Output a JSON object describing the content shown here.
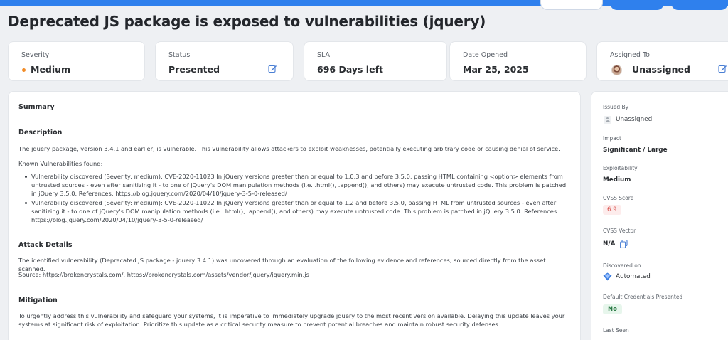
{
  "page": {
    "title": "Deprecated JS package is exposed to vulnerabilities (jquery)"
  },
  "cards": {
    "severity": {
      "label": "Severity",
      "value": "Medium",
      "dot_color": "#f28c28"
    },
    "status": {
      "label": "Status",
      "value": "Presented",
      "icon": "edit-icon"
    },
    "sla": {
      "label": "SLA",
      "value": "696 Days left"
    },
    "date_opened": {
      "label": "Date Opened",
      "value": "Mar 25, 2025"
    },
    "assigned_to": {
      "label": "Assigned To",
      "value": "Unassigned",
      "icon": "edit-icon"
    }
  },
  "main": {
    "summary_heading": "Summary",
    "description": {
      "heading": "Description",
      "text": "The jquery package, version 3.4.1 and earlier, is vulnerable. This vulnerability allows attackers to exploit weaknesses, potentially executing arbitrary code or causing denial of service.",
      "known_label": "Known Vulnerabilities found:",
      "items": [
        "Vulnerability discovered (Severity: medium): CVE-2020-11023 In jQuery versions greater than or equal to 1.0.3 and before 3.5.0, passing HTML containing <option> elements from untrusted sources - even after sanitizing it - to one of jQuery's DOM manipulation methods (i.e. .html(), .append(), and others) may execute untrusted code. This problem is patched in jQuery 3.5.0. References: https://blog.jquery.com/2020/04/10/jquery-3-5-0-released/",
        "Vulnerability discovered (Severity: medium): CVE-2020-11022 In jQuery versions greater than or equal to 1.2 and before 3.5.0, passing HTML from untrusted sources - even after sanitizing it - to one of jQuery's DOM manipulation methods (i.e. .html(), .append(), and others) may execute untrusted code. This problem is patched in jQuery 3.5.0. References: https://blog.jquery.com/2020/04/10/jquery-3-5-0-released/"
      ]
    },
    "attack": {
      "heading": "Attack Details",
      "text": "The identified vulnerability (Deprecated JS package - jquery 3.4.1) was uncovered through an evaluation of the following evidence and references, sourced directly from the asset scanned.",
      "source": "Source: https://brokencrystals.com/, https://brokencrystals.com/assets/vendor/jquery/jquery.min.js"
    },
    "mitigation": {
      "heading": "Mitigation",
      "text": "To urgently address this vulnerability and safeguard your systems, it is imperative to immediately upgrade jquery to the most recent version available. Delaying this update leaves your systems at significant risk of exploitation. Prioritize this update as a critical security measure to prevent potential breaches and maintain robust security defenses."
    }
  },
  "side": {
    "issued_by": {
      "label": "Issued By",
      "value": "Unassigned"
    },
    "impact": {
      "label": "Impact",
      "value": "Significant / Large"
    },
    "exploitability": {
      "label": "Exploitability",
      "value": "Medium"
    },
    "cvss_score": {
      "label": "CVSS Score",
      "value": "6.9",
      "color": "#d9534f"
    },
    "cvss_vector": {
      "label": "CVSS Vector",
      "value": "N/A"
    },
    "discovered_on": {
      "label": "Discovered on",
      "value": "Automated"
    },
    "default_credentials": {
      "label": "Default Credentials Presented",
      "value": "No"
    },
    "last_seen": {
      "label": "Last Seen"
    }
  }
}
